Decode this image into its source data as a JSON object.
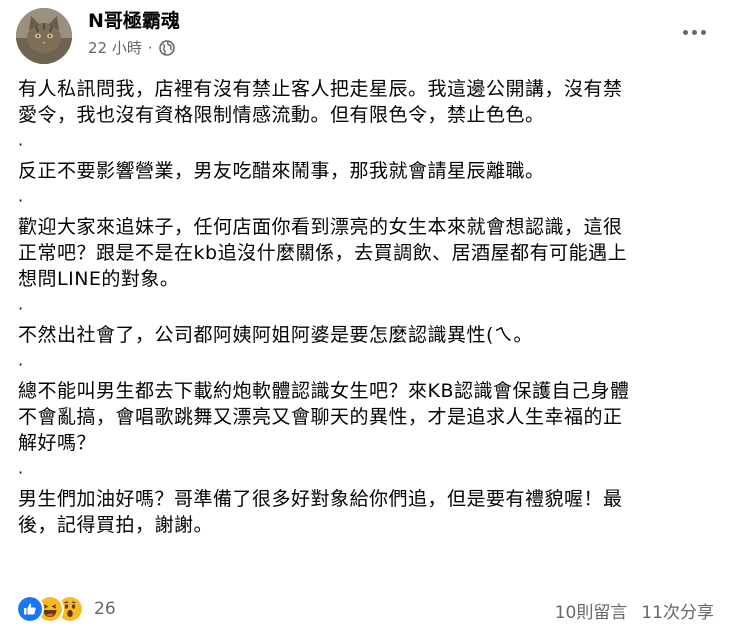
{
  "post": {
    "author": "N哥極霸魂",
    "time": "22 小時",
    "time_separator": "·",
    "privacy_icon": "globe-icon",
    "more_icon": "more-horizontal-icon",
    "paragraphs": [
      "有人私訊問我，店裡有沒有禁止客人把走星辰。我這邊公開講，沒有禁",
      "愛令，我也沒有資格限制情感流動。但有限色令，禁止色色。",
      "·",
      "反正不要影響營業，男友吃醋來鬧事，那我就會請星辰離職。",
      "·",
      "歡迎大家來追妹子，任何店面你看到漂亮的女生本來就會想認識，這很",
      "正常吧？跟是不是在kb追沒什麼關係，去買調飲、居酒屋都有可能遇上",
      "想問LINE的對象。",
      "·",
      "不然出社會了，公司都阿姨阿姐阿婆是要怎麼認識異性(ㄟ。",
      "·",
      "總不能叫男生都去下載約炮軟體認識女生吧？來KB認識會保護自己身體",
      "不會亂搞，會唱歌跳舞又漂亮又會聊天的異性，才是追求人生幸福的正",
      "解好嗎？",
      "·",
      "男生們加油好嗎？哥準備了很多好對象給你們追，但是要有禮貌喔！最",
      "後，記得買拍，謝謝。"
    ]
  },
  "footer": {
    "reactions": [
      "like-icon",
      "haha-icon",
      "wow-icon"
    ],
    "reaction_count": "26",
    "comments": "10則留言",
    "shares": "11次分享"
  },
  "colors": {
    "like_blue": "#1877f2",
    "emoji_yellow": "#f7b928",
    "secondary_text": "#65676b"
  }
}
